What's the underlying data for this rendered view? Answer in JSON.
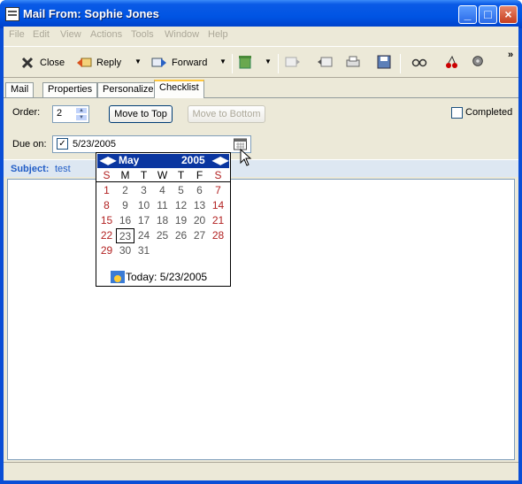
{
  "window": {
    "title": "Mail From: Sophie Jones",
    "controls": {
      "minimize": "_",
      "maximize": "□",
      "close": "×"
    }
  },
  "menubar": {
    "items": [
      "File",
      "Edit",
      "View",
      "Actions",
      "Tools",
      "Window",
      "Help"
    ]
  },
  "toolbar": {
    "close_label": "Close",
    "reply_label": "Reply",
    "forward_label": "Forward",
    "overflow": "»"
  },
  "tabs": [
    {
      "label": "Mail"
    },
    {
      "label": "Properties"
    },
    {
      "label": "Personalize"
    },
    {
      "label": "Checklist"
    }
  ],
  "checklist": {
    "order_label": "Order:",
    "order_value": "2",
    "move_top_label": "Move to Top",
    "move_bottom_label": "Move to Bottom",
    "completed_label": "Completed",
    "due_label": "Due on:",
    "due_checked": "✓",
    "due_value": "5/23/2005"
  },
  "subject": {
    "label": "Subject:",
    "value": "test"
  },
  "calendar": {
    "month": "May",
    "year": "2005",
    "weekdays": [
      "S",
      "M",
      "T",
      "W",
      "T",
      "F",
      "S"
    ],
    "weeks": [
      [
        "1",
        "2",
        "3",
        "4",
        "5",
        "6",
        "7"
      ],
      [
        "8",
        "9",
        "10",
        "11",
        "12",
        "13",
        "14"
      ],
      [
        "15",
        "16",
        "17",
        "18",
        "19",
        "20",
        "21"
      ],
      [
        "22",
        "23",
        "24",
        "25",
        "26",
        "27",
        "28"
      ],
      [
        "29",
        "30",
        "31",
        "",
        "",
        "",
        ""
      ]
    ],
    "selected_day": "23",
    "today_label": "Today: 5/23/2005"
  },
  "colors": {
    "title_blue": "#0054e3",
    "weekend_red": "#b22222",
    "calendar_header": "#0a36a0"
  }
}
